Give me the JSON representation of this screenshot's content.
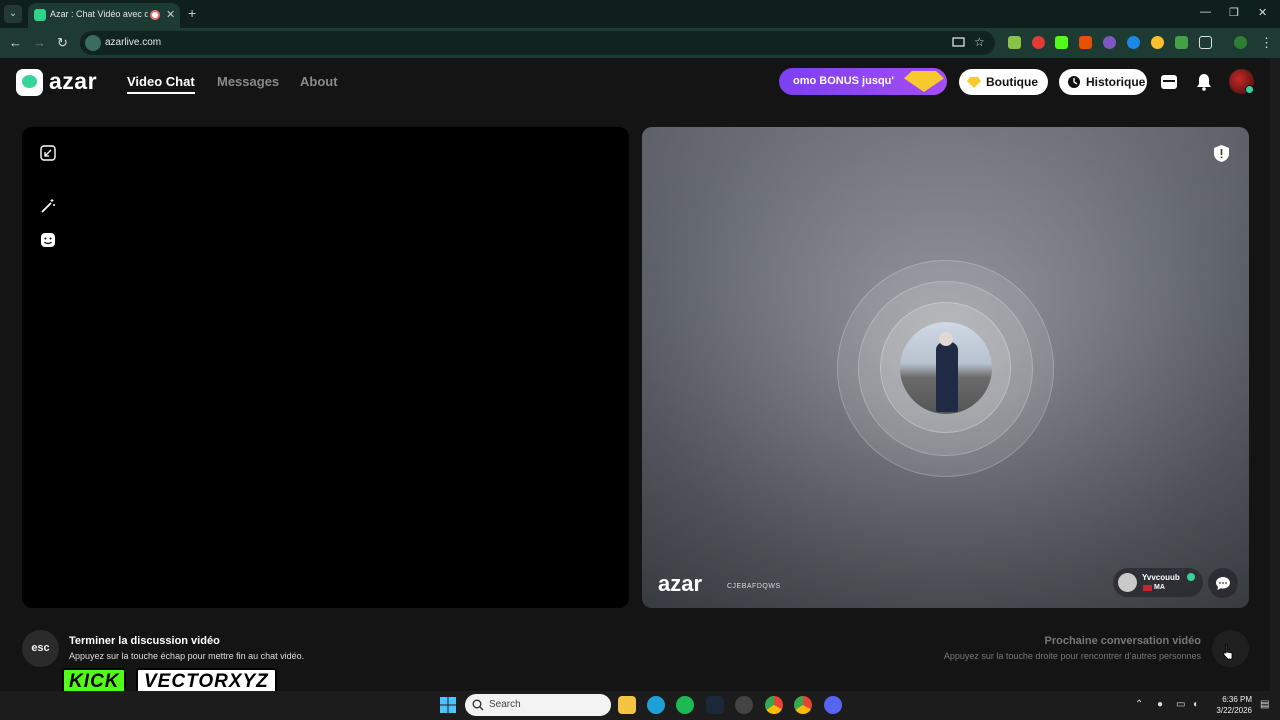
{
  "browser": {
    "tab_title": "Azar : Chat Vidéo avec de n",
    "url": "azarlive.com",
    "window_controls": [
      "—",
      "❐",
      "✕"
    ]
  },
  "header": {
    "logo_text": "azar",
    "nav": [
      {
        "label": "Video Chat",
        "active": true
      },
      {
        "label": "Messages",
        "active": false
      },
      {
        "label": "About",
        "active": false
      }
    ],
    "promo_text": "omo BONUS jusqu'",
    "shop_label": "Boutique",
    "history_label": "Historique"
  },
  "remote": {
    "watermark_logo": "azar",
    "watermark_code": "CJEBAFDQWS",
    "user_name": "Yvvcouub",
    "user_country": "MA"
  },
  "footer": {
    "esc_label": "esc",
    "end_title": "Terminer la discussion vidéo",
    "end_sub": "Appuyez sur la touche échap pour mettre fin au chat vidéo.",
    "next_title": "Prochaine conversation vidéo",
    "next_sub": "Appuyez sur la touche droite pour rencontrer d’autres personnes"
  },
  "overlay": {
    "kick_label": "KICK",
    "streamer_label": "VECTORXYZ"
  },
  "taskbar": {
    "search_placeholder": "Search",
    "time": "6:36 PM",
    "date": "3/22/2026"
  },
  "colors": {
    "accent": "#36d39a",
    "promo": "#8a45f3",
    "kick": "#53fc18"
  }
}
